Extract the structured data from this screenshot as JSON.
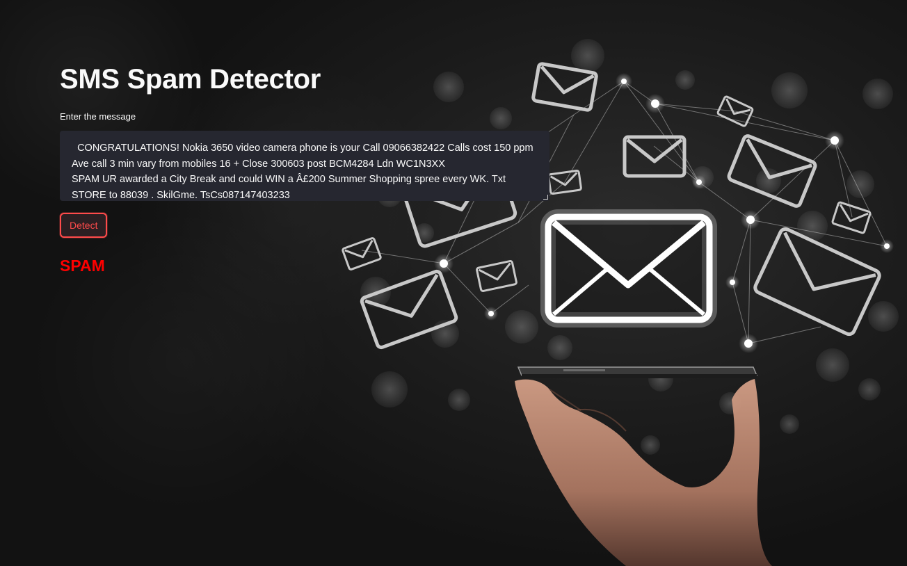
{
  "app": {
    "title": "SMS Spam Detector"
  },
  "input": {
    "label": "Enter the message",
    "value": "  CONGRATULATIONS! Nokia 3650 video camera phone is your Call 09066382422 Calls cost 150 ppm Ave call 3 min vary from mobiles 16 + Close 300603 post BCM4284 Ldn WC1N3XX\nSPAM UR awarded a City Break and could WIN a Â£200 Summer Shopping spree every WK. Txt STORE to 88039 . SkilGme. TsCs087147403233"
  },
  "actions": {
    "detect_label": "Detect"
  },
  "result": {
    "label": "SPAM",
    "color": "#ff0000"
  },
  "theme": {
    "accent": "#ff4b4b",
    "input_bg": "#262730",
    "text": "#fafafa"
  },
  "icons": [
    "envelope-icon",
    "network-node-icon",
    "smartphone-icon",
    "hand-icon"
  ]
}
